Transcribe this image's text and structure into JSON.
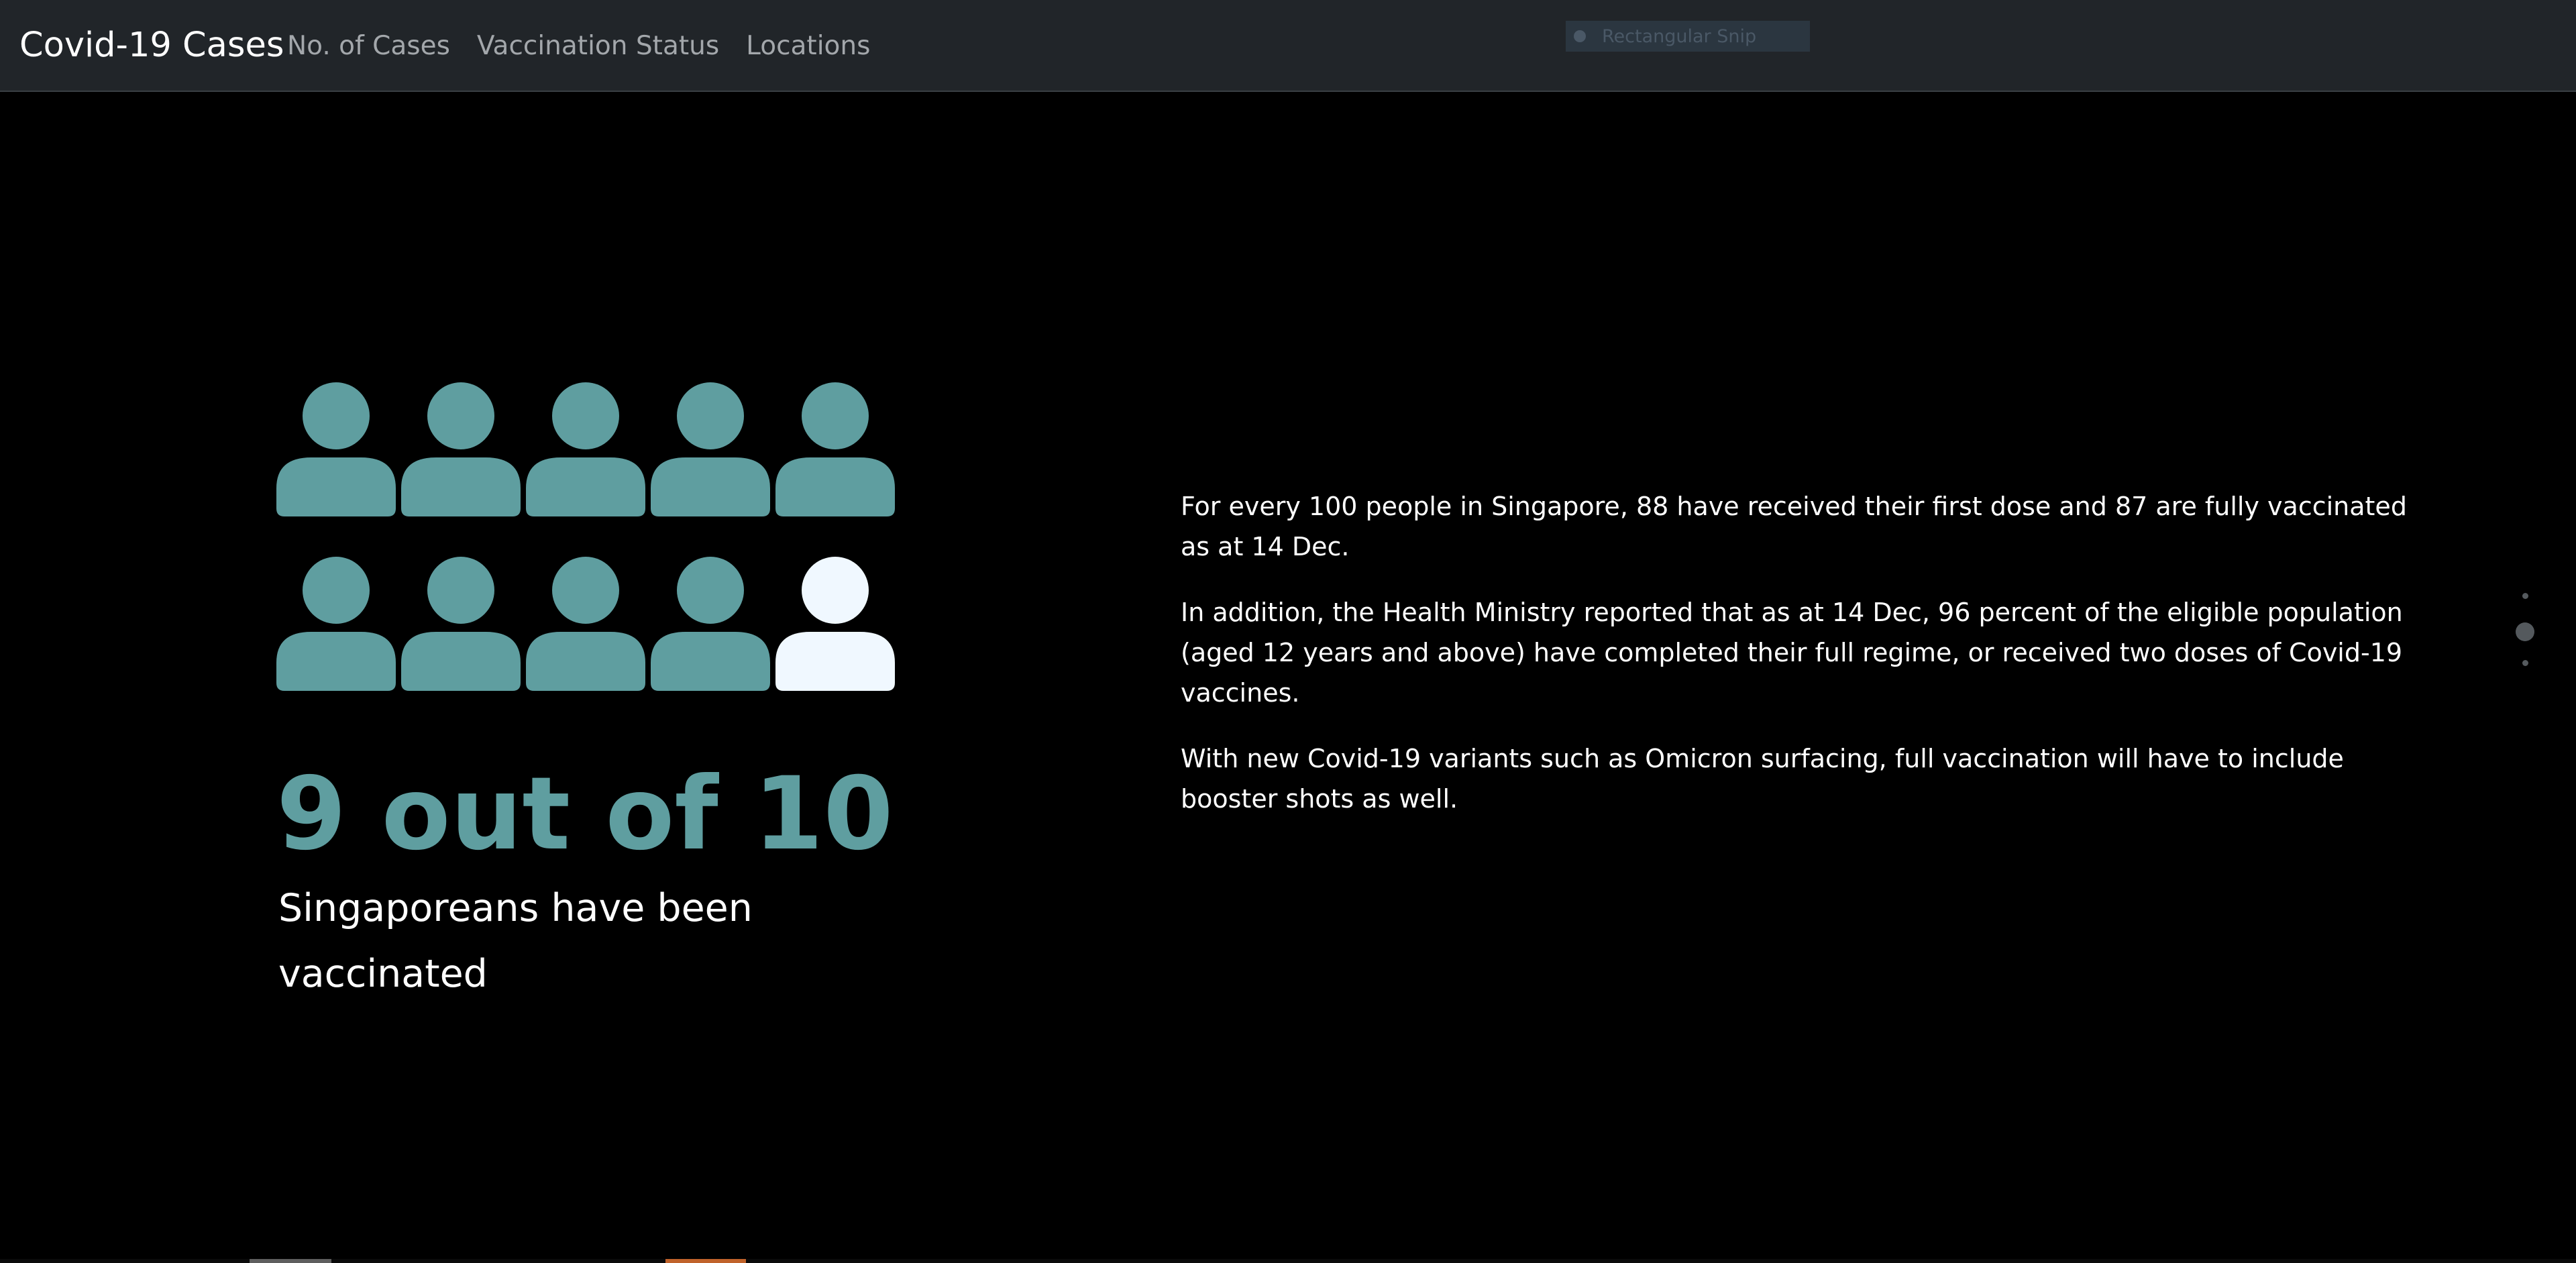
{
  "navbar": {
    "brand": "Covid-19 Cases",
    "links": [
      {
        "label": "No. of Cases"
      },
      {
        "label": "Vaccination Status"
      },
      {
        "label": "Locations"
      }
    ]
  },
  "snip_overlay": {
    "label": "Rectangular Snip"
  },
  "infographic": {
    "total": 10,
    "vaccinated": 9,
    "vaccinated_color": "#5f9ea0",
    "unvaccinated_color": "#f0f8ff",
    "headline": "9 out of 10",
    "caption": "Singaporeans have been vaccinated"
  },
  "article": {
    "paragraphs": [
      "For every 100 people in Singapore, 88 have received their first dose and 87 are fully vaccinated as at 14 Dec.",
      "In addition, the Health Ministry reported that as at 14 Dec, 96 percent of the eligible population (aged 12 years and above) have completed their full regime, or received two doses of Covid-19 vaccines.",
      "With new Covid-19 variants such as Omicron surfacing, full vaccination will have to include booster shots as well."
    ]
  },
  "pagination": {
    "count": 3,
    "active_index": 1
  }
}
